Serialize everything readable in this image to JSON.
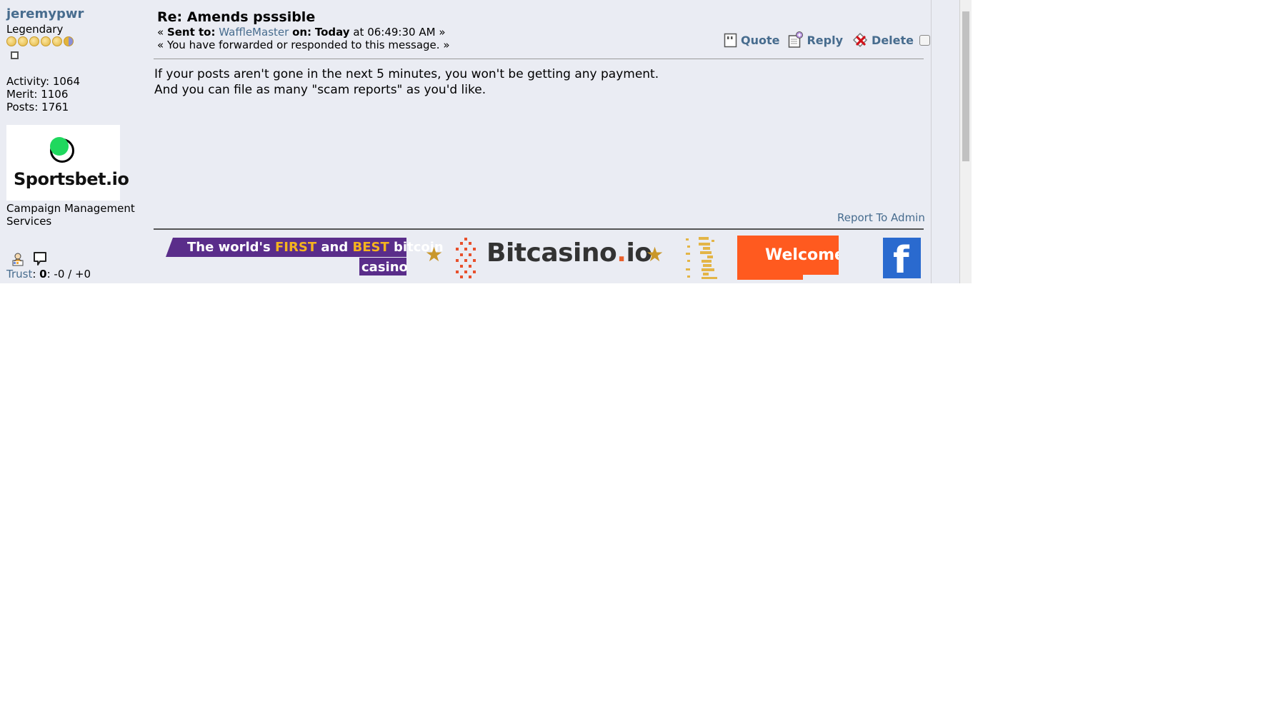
{
  "user": {
    "name": "jeremypwr",
    "rank": "Legendary",
    "activity": "Activity: 1064",
    "merit": "Merit: 1106",
    "posts": "Posts: 1761",
    "avatar_text": "Sportsbet.io",
    "personal_text": "Campaign Management Services",
    "trust_label": "Trust",
    "trust_value": "0",
    "trust_rest": ": -0 / +0"
  },
  "message": {
    "subject": "Re: Amends psssible",
    "sent_to_label": "Sent to:",
    "sent_to": "WaffleMaster",
    "on_label": "on:",
    "date": "Today",
    "time": "at 06:49:30 AM",
    "status": "« You have forwarded or responded to this message. »",
    "body": "If your posts aren't gone in the next 5 minutes, you won't be getting any payment.\nAnd you can file as many \"scam reports\" as you'd like.",
    "report": "Report To Admin"
  },
  "actions": {
    "quote": "Quote",
    "reply": "Reply",
    "delete": "Delete"
  },
  "ad": {
    "line1_a": "The world's ",
    "line1_b": "FIRST",
    "line1_c": " and ",
    "line1_d": "BEST",
    "line1_e": " bitcoin",
    "line2": "casino",
    "brand_a": "Bitcasino",
    "brand_dot": ".",
    "brand_b": "io",
    "welcome": "Welcome"
  },
  "colors": {
    "link": "#476c8e",
    "panel_bg": "#eaecf3",
    "ad_purple": "#5a2d8a",
    "ad_orange": "#ff5a1f",
    "ad_gold": "#c9972a",
    "facebook_blue": "#2a6acf",
    "avatar_green": "#1fd85e"
  },
  "icons": [
    "coin-star-icon",
    "checkbox-icon",
    "profile-icon",
    "message-icon",
    "quote-icon",
    "reply-icon",
    "delete-icon"
  ]
}
